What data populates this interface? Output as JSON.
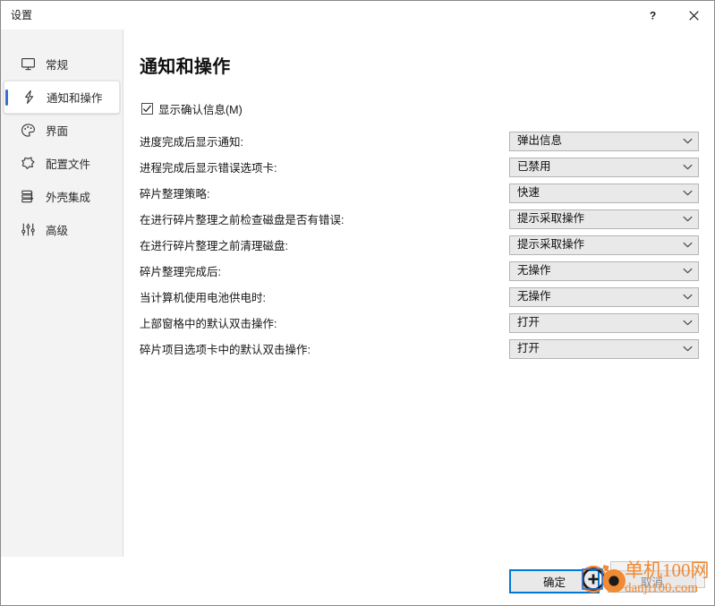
{
  "window": {
    "title": "设置",
    "help_label": "?",
    "close_label": "✕",
    "help_icon": "question-mark-icon",
    "close_icon": "close-icon"
  },
  "sidebar": {
    "items": [
      {
        "label": "常规",
        "icon": "monitor-icon",
        "selected": false
      },
      {
        "label": "通知和操作",
        "icon": "lightning-bolt-icon",
        "selected": true
      },
      {
        "label": "界面",
        "icon": "palette-icon",
        "selected": false
      },
      {
        "label": "配置文件",
        "icon": "profile-shape-icon",
        "selected": false
      },
      {
        "label": "外壳集成",
        "icon": "layers-icon",
        "selected": false
      },
      {
        "label": "高级",
        "icon": "sliders-icon",
        "selected": false
      }
    ]
  },
  "main": {
    "page_title": "通知和操作",
    "checkbox": {
      "label": "显示确认信息(M)",
      "checked": true,
      "icon": "checkmark-icon"
    },
    "settings": [
      {
        "label": "进度完成后显示通知:",
        "value": "弹出信息"
      },
      {
        "label": "进程完成后显示错误选项卡:",
        "value": "已禁用"
      },
      {
        "label": "碎片整理策略:",
        "value": "快速"
      },
      {
        "label": "在进行碎片整理之前检查磁盘是否有错误:",
        "value": "提示采取操作"
      },
      {
        "label": "在进行碎片整理之前清理磁盘:",
        "value": "提示采取操作"
      },
      {
        "label": "碎片整理完成后:",
        "value": "无操作"
      },
      {
        "label": "当计算机使用电池供电时:",
        "value": "无操作"
      },
      {
        "label": "上部窗格中的默认双击操作:",
        "value": "打开"
      },
      {
        "label": "碎片项目选项卡中的默认双击操作:",
        "value": "打开"
      }
    ],
    "dropdown_arrow_icon": "chevron-down-icon"
  },
  "footer": {
    "ok_label": "确定",
    "cancel_label": "取消"
  },
  "watermark": {
    "line1": "单机100网",
    "line2": "danji100.com",
    "logo_icon": "danji-logo-icon",
    "color": "#f08a33"
  },
  "colors": {
    "accent": "#3a72c4",
    "focus": "#0078d7",
    "sidebar_bg": "#f3f3f3",
    "combo_bg": "#e9e9e9",
    "combo_border": "#b4b4b4"
  }
}
